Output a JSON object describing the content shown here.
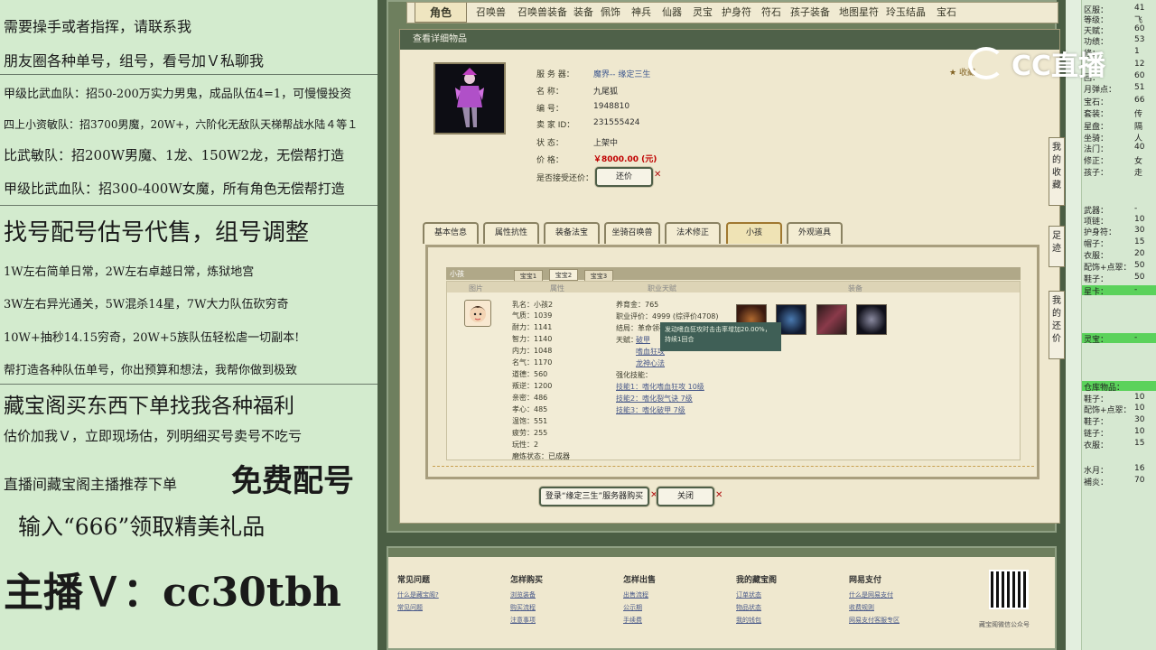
{
  "left_ads": [
    "需要操手或者指挥，请联系我",
    "朋友圈各种单号，组号，看号加Ｖ私聊我",
    "甲级比武血队：招50-200万实力男鬼，成品队伍4=1，可慢慢投资",
    "四上小资敏队：招3700男魔，20W+，六阶化无敌队天梯帮战水陆４等１",
    "比武敏队：招200W男魔、1龙、150W2龙，无偿帮打造",
    "甲级比武血队：招300-400W女魔，所有角色无偿帮打造",
    "找号配号估号代售，组号调整",
    "1W左右简单日常，2W左右卓越日常，炼狱地宫",
    "3W左右异光通关，5W混杀14星，7W大力队伍砍穷奇",
    "10W+抽秒14.15穷奇，20W+5族队伍轻松虐一切副本!",
    "帮打造各种队伍单号，你出预算和想法，我帮你做到极致",
    "藏宝阁买东西下单找我各种福利",
    "估价加我Ｖ，立即现场估，列明细买号卖号不吃亏",
    "直播间藏宝阁主播推荐下单",
    "免费配号",
    "输入“666”领取精美礼品",
    "主播Ｖ：cc30tbh"
  ],
  "top_tabs": [
    "角色",
    "召唤兽",
    "召唤兽装备",
    "装备",
    "佩饰",
    "神兵",
    "仙器",
    "灵宝",
    "护身符",
    "符石",
    "孩子装备",
    "地图星符",
    "玲玉结晶",
    "宝石"
  ],
  "panel_title": "查看详细物品",
  "fav_text": "收藏",
  "info": {
    "server_label": "服 务 器：",
    "server": "魔界-- 缘定三生",
    "name_label": "名         称：",
    "name": "九尾狐",
    "id_label": "编         号：",
    "id": "1948810",
    "seller_label": "卖 家   ID：",
    "seller": "231555424",
    "status_label": "状         态：",
    "status": "上架中",
    "price_label": "价         格：",
    "price": "￥8000.00 (元)",
    "bargain_label": "是否接受还价：",
    "bargain_btn": "还价"
  },
  "prop_tabs": [
    "基本信息",
    "属性抗性",
    "装备法宝",
    "坐骑召唤兽",
    "法术修正",
    "小孩",
    "外观道具"
  ],
  "child": {
    "section": "小孩",
    "sub_tabs": [
      "宝宝1",
      "宝宝2",
      "宝宝3"
    ],
    "col_headers": [
      "图片",
      "属性",
      "职业天赋",
      "装备"
    ],
    "attrs": [
      "乳名：小孩2",
      "气质：1039",
      "耐力：1141",
      "智力：1140",
      "内力：1048",
      "名气：1170",
      "道德：560",
      "叛逆：1200",
      "亲密：486",
      "孝心：485",
      "温饱：551",
      "疲劳：255",
      "玩性：2",
      "磨炼状态：已成器"
    ],
    "career": [
      "养育金：765",
      "职业评价：4999 (综评价4708)",
      "结局：革命领袖",
      "天赋：",
      "破甲",
      "嗜血狂攻",
      "龙神心法",
      "强化技能：",
      "技能1：嗜化嗜血狂攻 10级",
      "技能2：嗜化裂气诀 7级",
      "技能3：嗜化破甲 7级"
    ],
    "tooltip": "发动嗜血狂攻时击击率增加20.00%，持续1回合"
  },
  "buttons": {
    "buy": "登录“缘定三生”服务器购买",
    "close": "关闭"
  },
  "side_tabs": [
    "我的收藏",
    "足迹",
    "我的还价"
  ],
  "footer": [
    {
      "title": "常见问题",
      "links": [
        "什么是藏宝阁?",
        "常见问题"
      ]
    },
    {
      "title": "怎样购买",
      "links": [
        "浏览装备",
        "购买流程",
        "注意事项"
      ]
    },
    {
      "title": "怎样出售",
      "links": [
        "出售流程",
        "公示期",
        "手续费"
      ]
    },
    {
      "title": "我的藏宝阁",
      "links": [
        "订单状态",
        "物品状态",
        "我的钱包"
      ]
    },
    {
      "title": "网易支付",
      "links": [
        "什么是网易支付",
        "收费规则",
        "网易支付客服专区"
      ]
    }
  ],
  "qr_caption": "藏宝阁微信公众号",
  "right_stats": [
    [
      "区服：",
      "41"
    ],
    [
      "等级：",
      "飞"
    ],
    [
      "天赋：",
      "60"
    ],
    [
      "功绩：",
      "53"
    ],
    [
      "修：",
      "1"
    ],
    [
      "",
      "12"
    ],
    [
      "回：",
      "60"
    ],
    [
      "月弹点：",
      "51"
    ],
    [
      "宝石：",
      "66"
    ],
    [
      "套装：",
      "传"
    ],
    [
      "星盘：",
      "隔"
    ],
    [
      "坐骑：",
      "人"
    ],
    [
      "法门：",
      "40"
    ],
    [
      "修正：",
      "女"
    ],
    [
      "孩子：",
      "走"
    ],
    [
      "武器：",
      "-"
    ],
    [
      "项链：",
      "10"
    ],
    [
      "护身符：",
      "30"
    ],
    [
      "帽子：",
      "15"
    ],
    [
      "衣服：",
      "20"
    ],
    [
      "配饰+点翠：",
      "50"
    ],
    [
      "鞋子：",
      "50"
    ],
    [
      "星卡：",
      "-"
    ],
    [
      "灵宝：",
      "-"
    ],
    [
      "仓库物品：",
      ""
    ],
    [
      "鞋子：",
      "10"
    ],
    [
      "配饰+点翠：",
      "10"
    ],
    [
      "鞋子：",
      "30"
    ],
    [
      "链子：",
      "10"
    ],
    [
      "衣服：",
      "15"
    ],
    [
      "水月：",
      "16"
    ],
    [
      "補炎：",
      "70"
    ]
  ],
  "watermark": "CC直播"
}
